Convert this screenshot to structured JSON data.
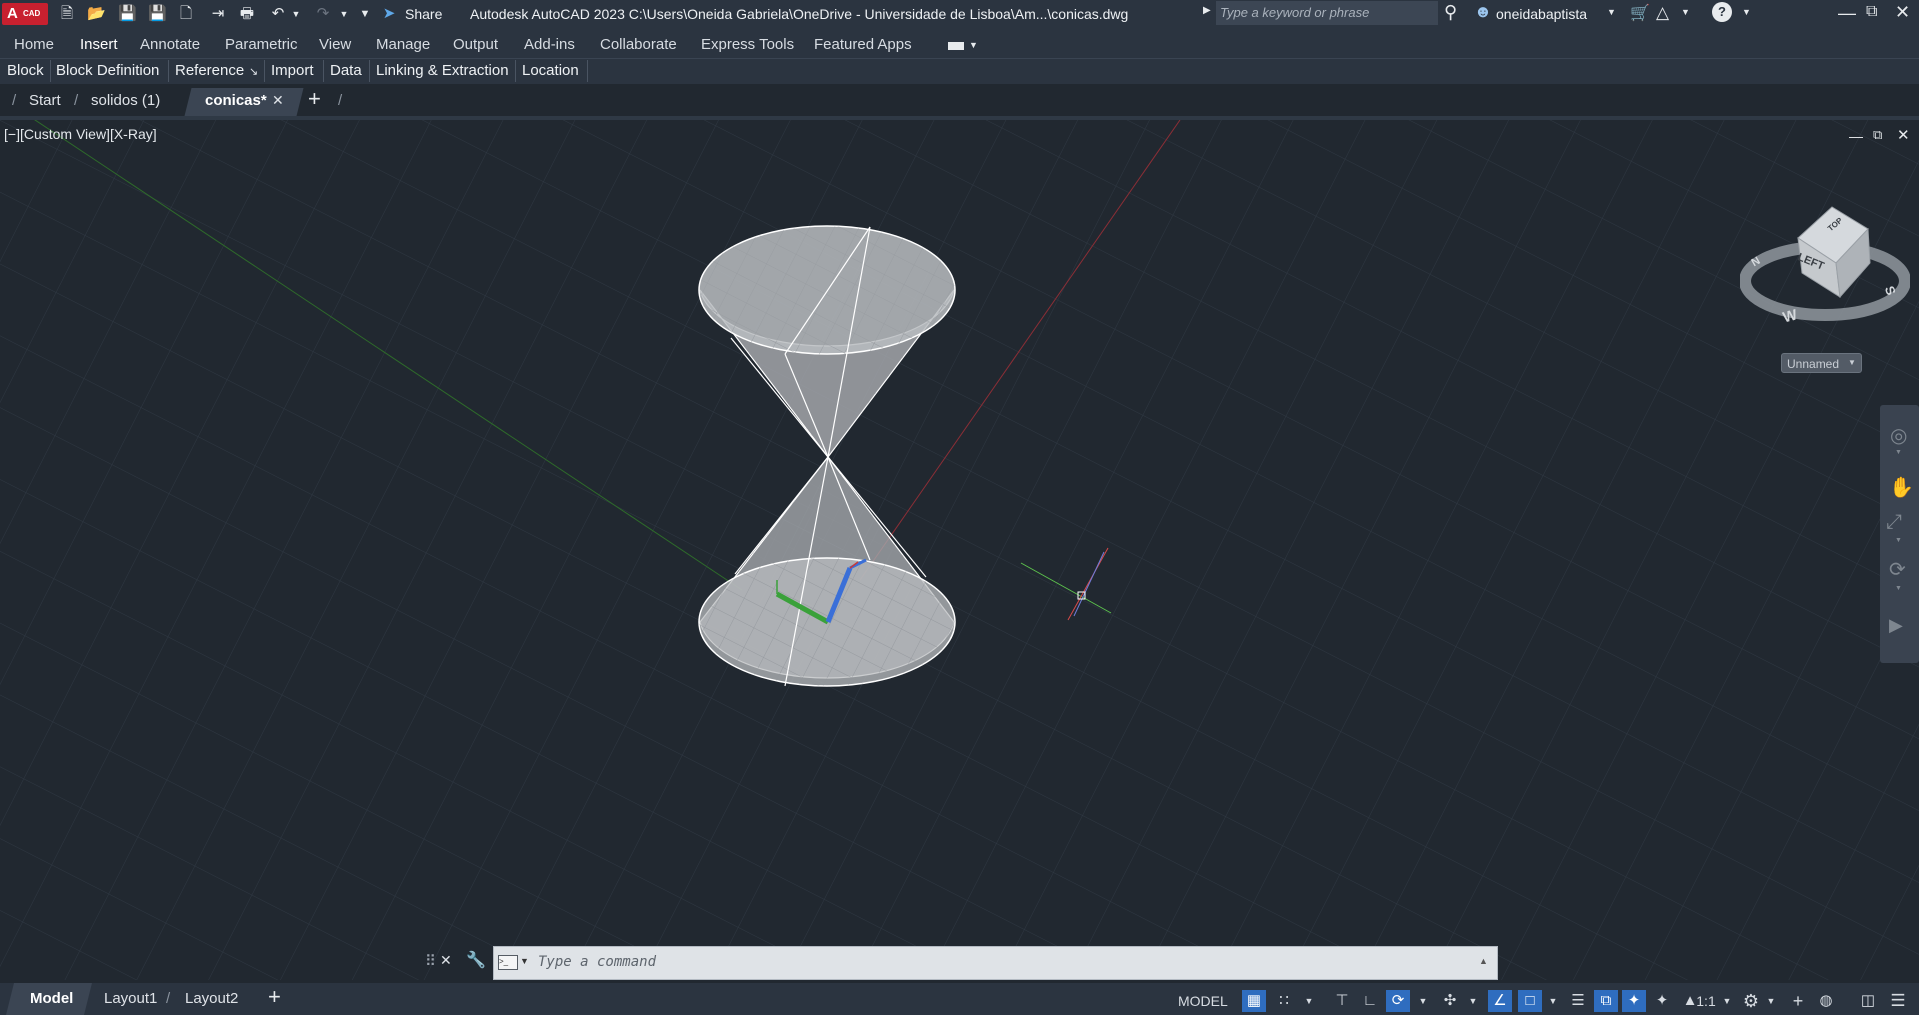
{
  "app": {
    "logo_main": "A",
    "logo_sub": "CAD",
    "title": "Autodesk AutoCAD 2023    C:\\Users\\Oneida Gabriela\\OneDrive - Universidade de Lisboa\\Am...\\conicas.dwg",
    "share_label": "Share",
    "search_placeholder": "Type a keyword or phrase",
    "username": "oneidabaptista"
  },
  "ribbon_tabs": [
    "Home",
    "Insert",
    "Annotate",
    "Parametric",
    "View",
    "Manage",
    "Output",
    "Add-ins",
    "Collaborate",
    "Express Tools",
    "Featured Apps"
  ],
  "active_ribbon_tab": "Insert",
  "panels": [
    "Block",
    "Block Definition",
    "Reference",
    "Import",
    "Data",
    "Linking & Extraction",
    "Location"
  ],
  "file_tabs": [
    "Start",
    "solidos (1)",
    "conicas*"
  ],
  "active_file_tab": "conicas*",
  "viewport": {
    "label": "[−][Custom View][X-Ray]",
    "viewcube_face": "LEFT",
    "viewcube_top": "TOP",
    "compass": {
      "n": "N",
      "s": "S",
      "w": "W"
    },
    "ucs_name": "Unnamed"
  },
  "command": {
    "placeholder": "Type a command"
  },
  "layout_tabs": [
    "Model",
    "Layout1",
    "Layout2"
  ],
  "active_layout_tab": "Model",
  "status": {
    "model_label": "MODEL",
    "scale": "1:1"
  },
  "colors": {
    "background": "#212830",
    "grid": "#2f3843",
    "x_axis": "#8b2e36",
    "y_axis": "#2e6b2a",
    "accent": "#2f6dbf",
    "logo": "#c8202f"
  }
}
